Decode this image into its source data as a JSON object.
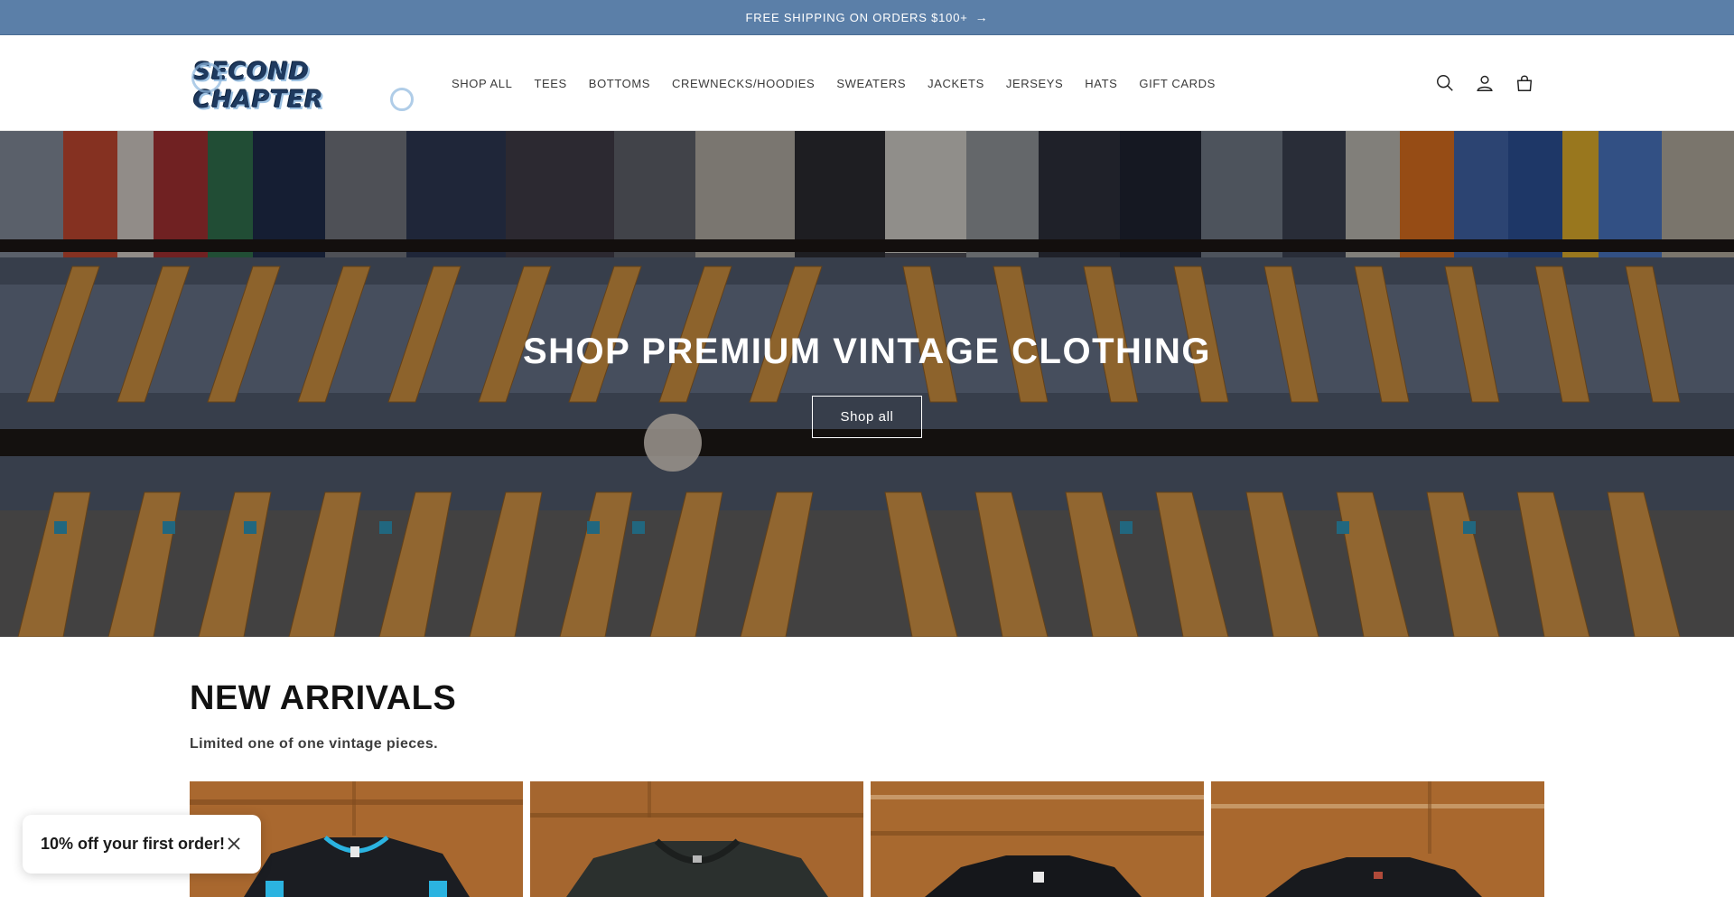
{
  "announcement": {
    "text": "FREE SHIPPING ON ORDERS $100+",
    "arrow_icon": "arrow-right-icon"
  },
  "header": {
    "logo_text": "SECOND CHAPTER",
    "nav": [
      {
        "label": "SHOP ALL"
      },
      {
        "label": "TEES"
      },
      {
        "label": "BOTTOMS"
      },
      {
        "label": "CREWNECKS/HOODIES"
      },
      {
        "label": "SWEATERS"
      },
      {
        "label": "JACKETS"
      },
      {
        "label": "JERSEYS"
      },
      {
        "label": "HATS"
      },
      {
        "label": "GIFT CARDS"
      }
    ],
    "icons": [
      "search-icon",
      "account-icon",
      "cart-icon"
    ]
  },
  "hero": {
    "title": "SHOP PREMIUM VINTAGE CLOTHING",
    "button_label": "Shop all"
  },
  "new_arrivals": {
    "title": "NEW ARRIVALS",
    "subtitle": "Limited one of one vintage pieces."
  },
  "popup": {
    "text": "10% off your first order!",
    "close_icon": "close-icon"
  },
  "colors": {
    "announcement_bg": "#5b7fa8",
    "logo_blue": "#1f3a5f",
    "text_dark": "#121212"
  }
}
